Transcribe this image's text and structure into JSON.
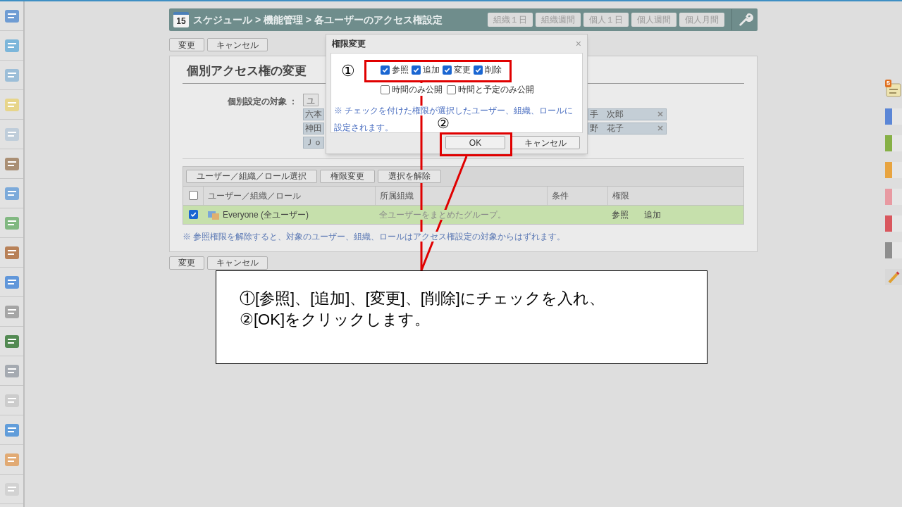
{
  "header": {
    "title": "スケジュール > 機能管理 > 各ユーザーのアクセス権設定",
    "date_badge": "15",
    "view_buttons": [
      "組織１日",
      "組織週間",
      "個人１日",
      "個人週間",
      "個人月間"
    ]
  },
  "top_buttons": [
    "変更",
    "キャンセル"
  ],
  "panel": {
    "heading": "個別アクセス権の変更",
    "target_label": "個別設定の対象 ：",
    "target_button": "ユ",
    "targets_left": [
      "六本",
      "神田",
      "Ｊｏ"
    ],
    "targets_right": [
      "手　次郎",
      "野　花子"
    ],
    "toolbar": [
      "ユーザー／組織／ロール選択",
      "権限変更",
      "選択を解除"
    ],
    "table": {
      "header_checked": false,
      "columns": [
        "ユーザー／組織／ロール",
        "所属組織",
        "条件",
        "権限"
      ],
      "rows": [
        {
          "checked": true,
          "name": "Everyone (全ユーザー)",
          "org": "全ユーザーをまとめたグループ。",
          "permissions": [
            "参照",
            "追加"
          ]
        }
      ]
    },
    "note": "※ 参照権限を解除すると、対象のユーザー、組織、ロールはアクセス権設定の対象からはずれます。"
  },
  "bottom_buttons": [
    "変更",
    "キャンセル"
  ],
  "right_strip": {
    "badge": "5",
    "tabs": [
      {
        "color": "#5b86d6"
      },
      {
        "color": "#86b046"
      },
      {
        "color": "#e8a440"
      },
      {
        "color": "#e89aa2"
      },
      {
        "color": "#d9575e"
      },
      {
        "color": "#8e8e8e"
      }
    ]
  },
  "dialog": {
    "title": "権限変更",
    "close": "×",
    "permissions": [
      {
        "label": "参照",
        "checked": true
      },
      {
        "label": "追加",
        "checked": true
      },
      {
        "label": "変更",
        "checked": true
      },
      {
        "label": "削除",
        "checked": true
      }
    ],
    "publish": [
      {
        "label": "時間のみ公開",
        "checked": false
      },
      {
        "label": "時間と予定のみ公開",
        "checked": false
      }
    ],
    "note": "※ チェックを付けた権限が選択したユーザー、組織、ロールに設定されます。",
    "buttons": [
      "OK",
      "キャンセル"
    ]
  },
  "annotation": {
    "markers": [
      "①",
      "②"
    ],
    "callout": [
      "①[参照]、[追加]、[変更]、[削除]にチェックを入れ、",
      "②[OK]をクリックします。"
    ]
  }
}
